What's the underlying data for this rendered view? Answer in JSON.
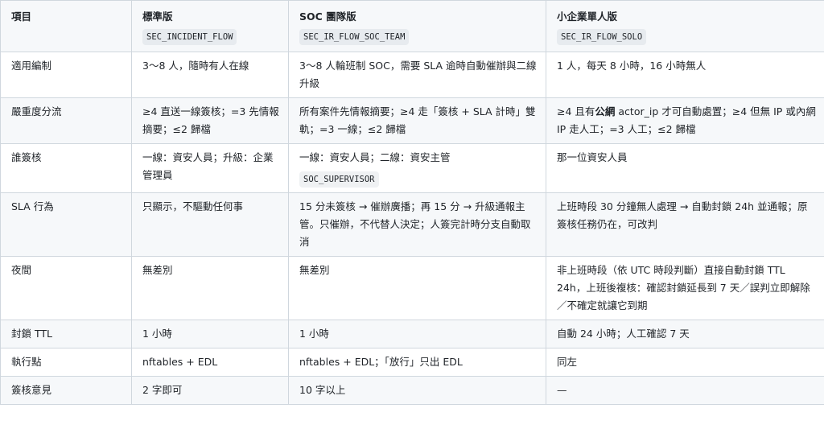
{
  "header": {
    "col0": "項目",
    "col1_title": "標準版",
    "col1_code": "SEC_INCIDENT_FLOW",
    "col2_title": "SOC 團隊版",
    "col2_code": "SEC_IR_FLOW_SOC_TEAM",
    "col3_title": "小企業單人版",
    "col3_code": "SEC_IR_FLOW_SOLO"
  },
  "rows": [
    {
      "item": "適用編制",
      "standard": "3～8 人，隨時有人在線",
      "soc": "3～8 人輪班制 SOC，需要 SLA 逾時自動催辦與二線升級",
      "solo": "1 人，每天 8 小時，16 小時無人"
    },
    {
      "item": "嚴重度分流",
      "standard": "≥4 直送一線簽核；=3 先情報摘要；≤2 歸檔",
      "soc": "所有案件先情報摘要；≥4 走「簽核 + SLA 計時」雙軌；=3 一線；≤2 歸檔",
      "solo_pre": "≥4 且有",
      "solo_bold": "公網",
      "solo_post": " actor_ip 才可自動處置；≥4 但無 IP 或內網 IP 走人工；=3 人工；≤2 歸檔"
    },
    {
      "item": "誰簽核",
      "standard": "一線：資安人員；升級：企業管理員",
      "soc": "一線：資安人員；二線：資安主管",
      "soc_code": "SOC_SUPERVISOR",
      "solo": "那一位資安人員"
    },
    {
      "item": "SLA 行為",
      "standard": "只顯示，不驅動任何事",
      "soc": "15 分未簽核 → 催辦廣播；再 15 分 → 升級通報主管。只催辦，不代替人決定；人簽完計時分支自動取消",
      "solo": "上班時段 30 分鐘無人處理 → 自動封鎖 24h 並通報；原簽核任務仍在，可改判"
    },
    {
      "item": "夜間",
      "standard": "無差別",
      "soc": "無差別",
      "solo": "非上班時段（依 UTC 時段判斷）直接自動封鎖 TTL 24h，上班後複核：確認封鎖延長到 7 天／誤判立即解除／不確定就讓它到期"
    },
    {
      "item": "封鎖 TTL",
      "standard": "1 小時",
      "soc": "1 小時",
      "solo": "自動 24 小時；人工確認 7 天"
    },
    {
      "item": "執行點",
      "standard": "nftables + EDL",
      "soc": "nftables + EDL；「放行」只出 EDL",
      "solo": "同左"
    },
    {
      "item": "簽核意見",
      "standard": "2 字即可",
      "soc": "10 字以上",
      "solo": "—"
    }
  ]
}
